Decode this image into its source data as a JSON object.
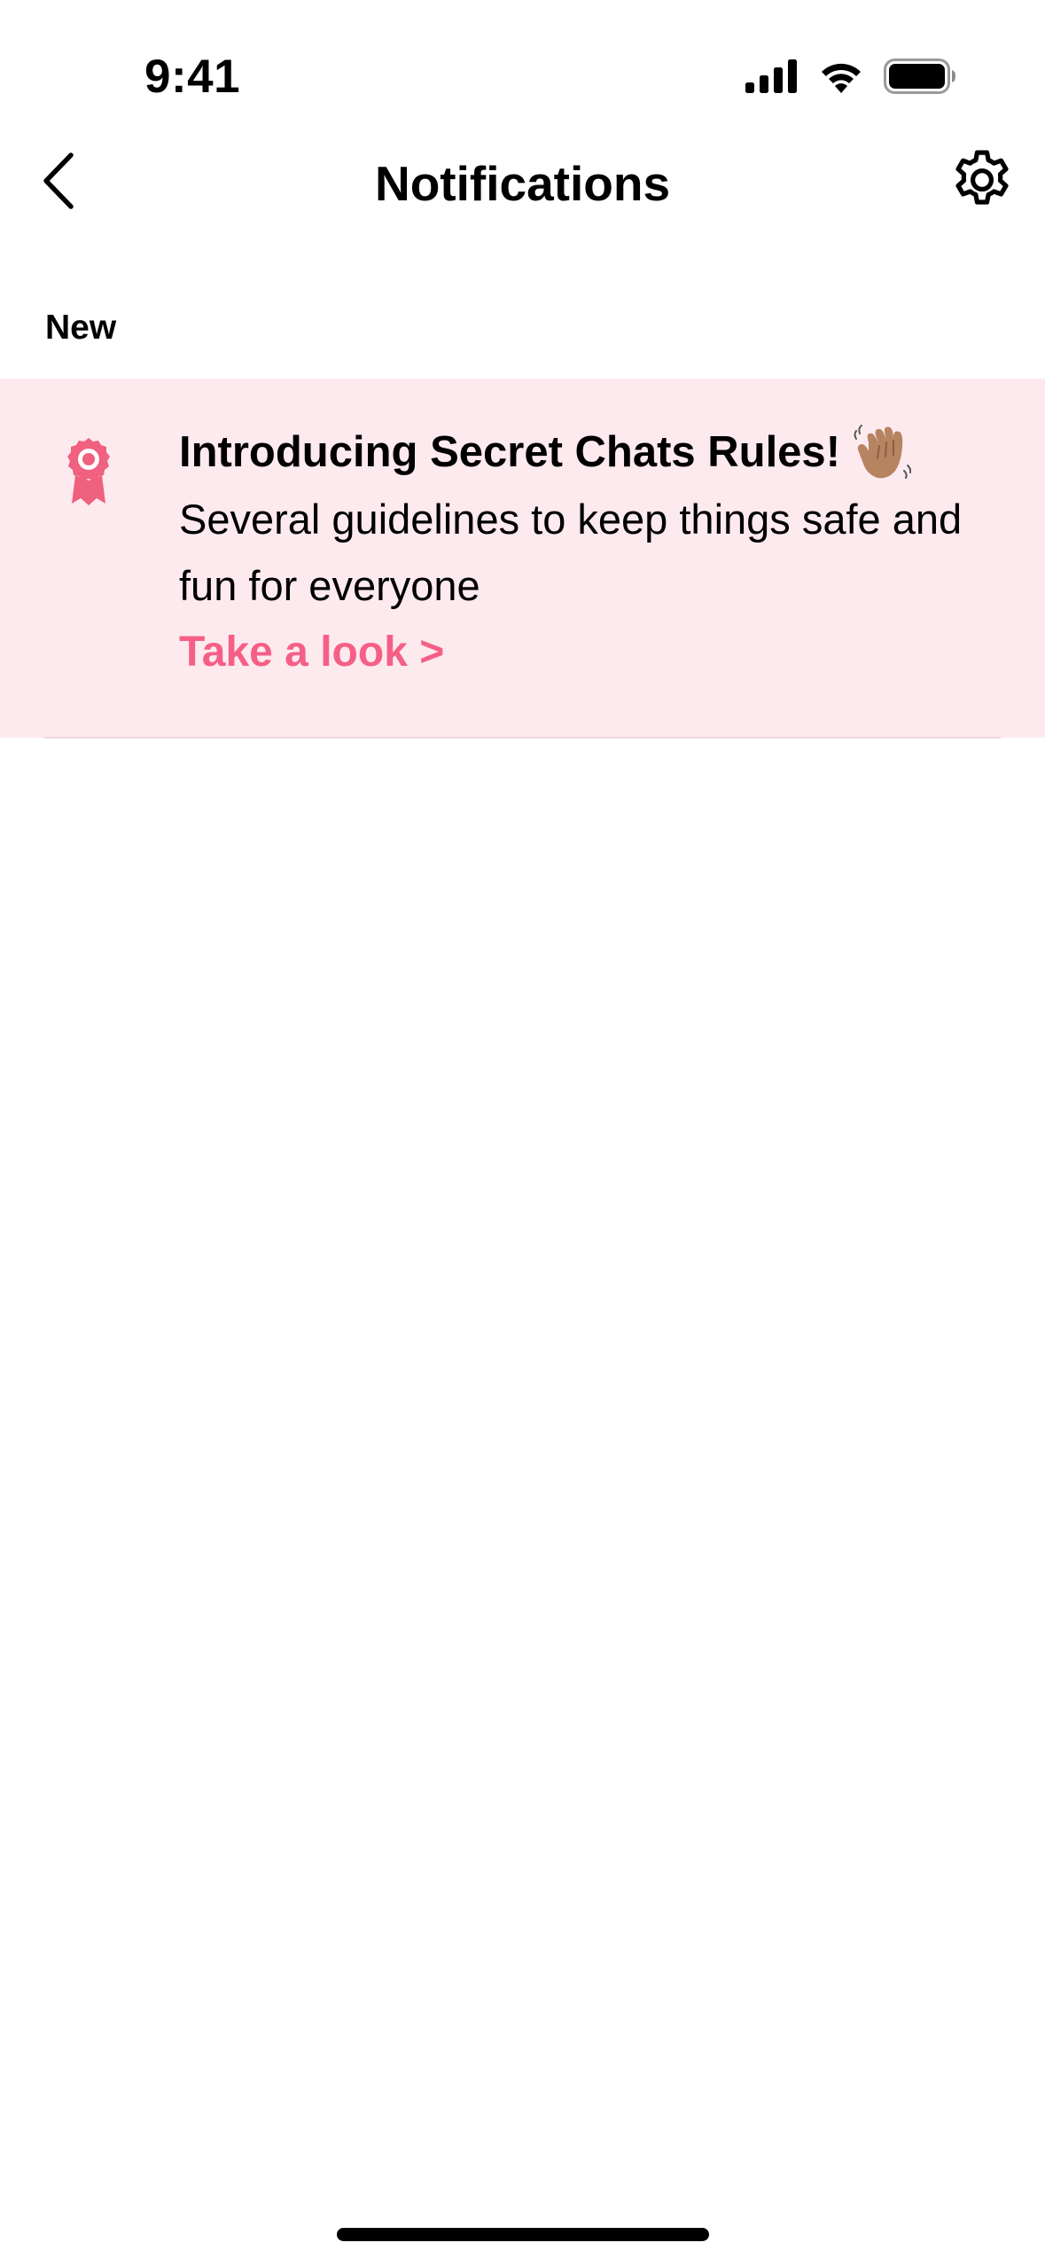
{
  "status_bar": {
    "time": "9:41",
    "icons": [
      "cellular-signal-icon",
      "wifi-icon",
      "battery-icon"
    ]
  },
  "nav": {
    "back_icon": "chevron-left-icon",
    "title": "Notifications",
    "settings_icon": "gear-icon"
  },
  "section": {
    "label": "New"
  },
  "notifications": [
    {
      "icon": "award-ribbon-icon",
      "title": "Introducing Secret Chats Rules!",
      "title_emoji": "waving-hand-icon",
      "body": "Several guidelines to keep things safe and fun for everyone",
      "link": "Take a look >"
    }
  ],
  "colors": {
    "accent": "#f55f86",
    "card_background": "#fdeaee",
    "badge": "#f0607f",
    "text": "#000000",
    "background": "#ffffff"
  }
}
